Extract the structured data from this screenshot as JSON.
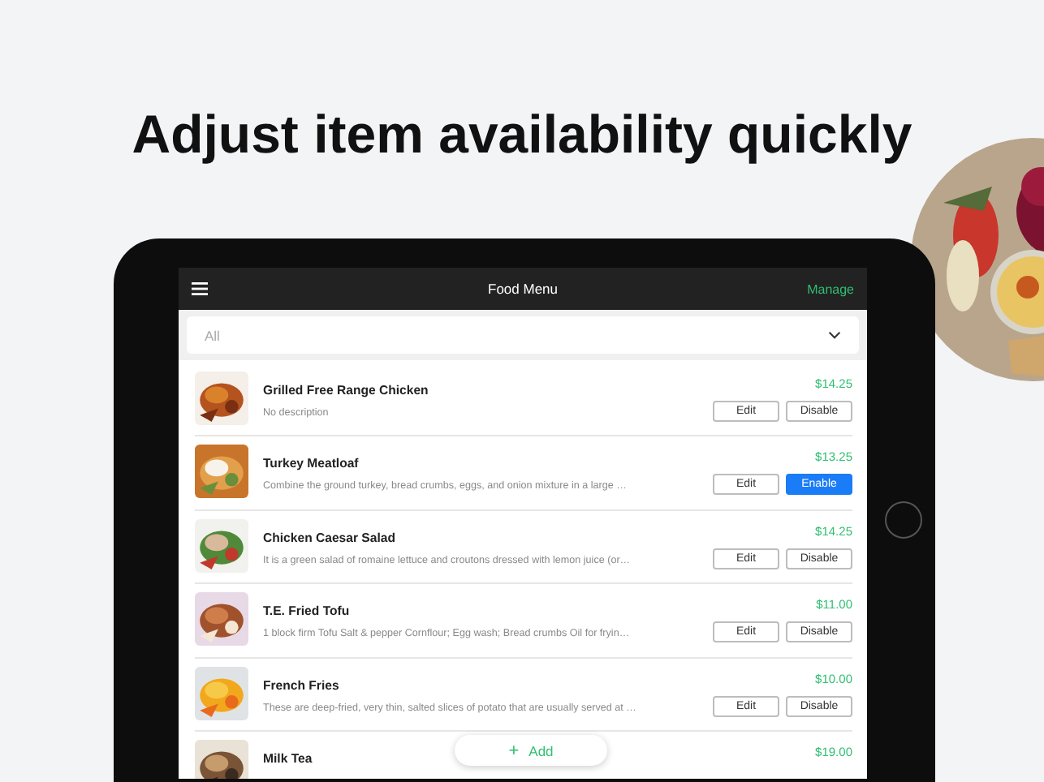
{
  "headline": "Adjust item availability quickly",
  "app": {
    "title": "Food Menu",
    "action": "Manage",
    "filter": {
      "value": "All"
    },
    "items": [
      {
        "name": "Grilled Free Range Chicken",
        "description": "No description",
        "price": "$14.25",
        "edit": "Edit",
        "toggle": "Disable",
        "enabled": true
      },
      {
        "name": "Turkey Meatloaf",
        "description": "Combine the ground turkey, bread crumbs, eggs, and onion mixture in a large …",
        "price": "$13.25",
        "edit": "Edit",
        "toggle": "Enable",
        "enabled": false
      },
      {
        "name": "Chicken Caesar Salad",
        "description": "It is a green salad of romaine lettuce and croutons dressed with lemon juice (or…",
        "price": "$14.25",
        "edit": "Edit",
        "toggle": "Disable",
        "enabled": true
      },
      {
        "name": "T.E. Fried Tofu",
        "description": "1 block firm Tofu Salt & pepper Cornflour; Egg wash; Bread crumbs Oil for fryin…",
        "price": "$11.00",
        "edit": "Edit",
        "toggle": "Disable",
        "enabled": true
      },
      {
        "name": "French Fries",
        "description": "These are deep-fried, very thin, salted slices of potato that are usually served at …",
        "price": "$10.00",
        "edit": "Edit",
        "toggle": "Disable",
        "enabled": true
      },
      {
        "name": "Milk Tea",
        "price": "$19.00"
      }
    ],
    "add_button": {
      "icon": "+",
      "label": "Add"
    }
  }
}
